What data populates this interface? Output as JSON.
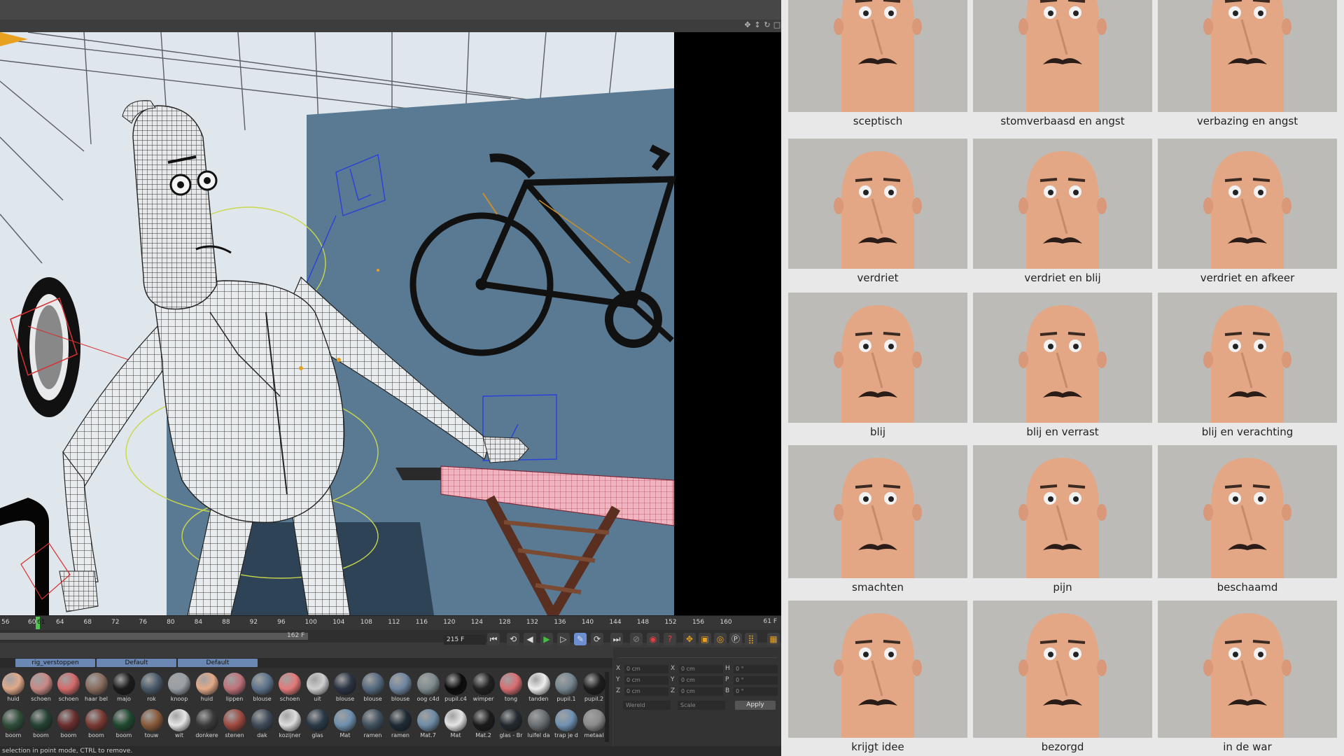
{
  "timeline": {
    "ticks": [
      "56",
      "60",
      "61",
      "64",
      "68",
      "72",
      "76",
      "80",
      "84",
      "88",
      "92",
      "96",
      "100",
      "104",
      "108",
      "112",
      "116",
      "120",
      "124",
      "128",
      "132",
      "136",
      "140",
      "144",
      "148",
      "152",
      "156",
      "160"
    ],
    "frame_readout": "61 F",
    "range_end": "162 F",
    "frame_field": "215 F",
    "current_frame": 61
  },
  "transport": {
    "icons": [
      "go-start-icon",
      "prev-key-icon",
      "prev-frame-icon",
      "play-icon",
      "next-frame-icon",
      "record-icon",
      "next-key-icon",
      "go-end-icon"
    ]
  },
  "materials": {
    "tabs": [
      "rig_verstoppen",
      "Default",
      "Default"
    ],
    "row1": [
      {
        "label": "huid",
        "color": "#e0a98a"
      },
      {
        "label": "schoen",
        "color": "#c98a86"
      },
      {
        "label": "schoen",
        "color": "#d46b6b"
      },
      {
        "label": "haar bel",
        "color": "#8a6d5e"
      },
      {
        "label": "majo",
        "color": "#1b1b1b"
      },
      {
        "label": "rok",
        "color": "#4a5a6a"
      },
      {
        "label": "knoop",
        "color": "#9aa0a6"
      },
      {
        "label": "huid",
        "color": "#e4aa88"
      },
      {
        "label": "lippen",
        "color": "#c0727a"
      },
      {
        "label": "blouse",
        "color": "#5d738c"
      },
      {
        "label": "schoen",
        "color": "#e47a7a"
      },
      {
        "label": "uit",
        "color": "#cfcfcf"
      },
      {
        "label": "blouse",
        "color": "#2b3444"
      },
      {
        "label": "blouse",
        "color": "#566a80"
      },
      {
        "label": "blouse",
        "color": "#6f85a0"
      },
      {
        "label": "oog c4d",
        "color": "#7f8b8f"
      },
      {
        "label": "pupil.c4",
        "color": "#0a0a0a"
      },
      {
        "label": "wimper",
        "color": "#202020"
      },
      {
        "label": "tong",
        "color": "#d86e72"
      },
      {
        "label": "tanden",
        "color": "#eeeeee"
      },
      {
        "label": "pupil.1",
        "color": "#768790"
      },
      {
        "label": "pupil.2",
        "color": "#1d1d1d"
      }
    ],
    "row2": [
      {
        "label": "boom",
        "color": "#2f4e3a"
      },
      {
        "label": "boom",
        "color": "#244232"
      },
      {
        "label": "boom",
        "color": "#6b2f2f"
      },
      {
        "label": "boom",
        "color": "#7a3a32"
      },
      {
        "label": "boom",
        "color": "#1f4a30"
      },
      {
        "label": "touw",
        "color": "#8a5a3a"
      },
      {
        "label": "wit",
        "color": "#e6e6e6"
      },
      {
        "label": "donkere",
        "color": "#3a3a3a"
      },
      {
        "label": "stenen",
        "color": "#a04a40"
      },
      {
        "label": "dak",
        "color": "#3f4a58"
      },
      {
        "label": "kozijner",
        "color": "#dddddd"
      },
      {
        "label": "glas",
        "color": "#2a3a48"
      },
      {
        "label": "Mat",
        "color": "#6d8fae"
      },
      {
        "label": "ramen",
        "color": "#40505e"
      },
      {
        "label": "ramen",
        "color": "#1e2a34"
      },
      {
        "label": "Mat.7",
        "color": "#6e8ca6"
      },
      {
        "label": "Mat",
        "color": "#e4e4e4"
      },
      {
        "label": "Mat.2",
        "color": "#1b1b1b"
      },
      {
        "label": "glas - Br",
        "color": "#222a30"
      },
      {
        "label": "luifel da",
        "color": "#6a6f74"
      },
      {
        "label": "trap je d",
        "color": "#6f92b3"
      },
      {
        "label": "metaal",
        "color": "#8a8a8a"
      }
    ]
  },
  "coords": {
    "rows": [
      {
        "a": "X",
        "av": "0 cm",
        "b": "X",
        "bv": "0 cm",
        "c": "H",
        "cv": "0 °"
      },
      {
        "a": "Y",
        "av": "0 cm",
        "b": "Y",
        "bv": "0 cm",
        "c": "P",
        "cv": "0 °"
      },
      {
        "a": "Z",
        "av": "0 cm",
        "b": "Z",
        "bv": "0 cm",
        "c": "B",
        "cv": "0 °"
      }
    ],
    "space_select": "Wereld",
    "scale_select": "Scale",
    "apply_label": "Apply"
  },
  "status": "selection in point mode, CTRL to remove.",
  "expressions": [
    "sceptisch",
    "stomverbaasd en angst",
    "verbazing en angst",
    "verdriet",
    "verdriet en blij",
    "verdriet en afkeer",
    "blij",
    "blij en verrast",
    "blij en verachting",
    "smachten",
    "pijn",
    "beschaamd",
    "krijgt idee",
    "bezorgd",
    "in de war"
  ],
  "colors": {
    "wall_blue": "#5a7a94",
    "room_white": "#dfe6ec",
    "playhead": "#4fc44f",
    "tab_blue": "#6b88b4",
    "skin": "#e3a786"
  }
}
